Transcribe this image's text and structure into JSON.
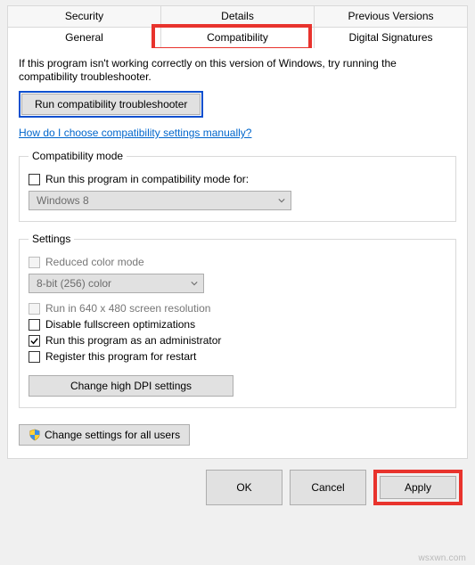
{
  "tabs": {
    "row1": [
      "Security",
      "Details",
      "Previous Versions"
    ],
    "row2": [
      "General",
      "Compatibility",
      "Digital Signatures"
    ],
    "active": "Compatibility"
  },
  "intro": "If this program isn't working correctly on this version of Windows, try running the compatibility troubleshooter.",
  "run_troubleshooter": "Run compatibility troubleshooter",
  "help_link": "How do I choose compatibility settings manually?",
  "compat_mode": {
    "legend": "Compatibility mode",
    "checkbox_label": "Run this program in compatibility mode for:",
    "checkbox_checked": false,
    "combo_value": "Windows 8"
  },
  "settings": {
    "legend": "Settings",
    "reduced_color": {
      "label": "Reduced color mode",
      "checked": false,
      "disabled": true
    },
    "color_combo": "8-bit (256) color",
    "run_640": {
      "label": "Run in 640 x 480 screen resolution",
      "checked": false,
      "disabled": true
    },
    "disable_fullscreen": {
      "label": "Disable fullscreen optimizations",
      "checked": false
    },
    "run_admin": {
      "label": "Run this program as an administrator",
      "checked": true
    },
    "register_restart": {
      "label": "Register this program for restart",
      "checked": false
    },
    "dpi_button": "Change high DPI settings"
  },
  "all_users_button": "Change settings for all users",
  "footer": {
    "ok": "OK",
    "cancel": "Cancel",
    "apply": "Apply"
  },
  "watermark": "wsxwn.com"
}
